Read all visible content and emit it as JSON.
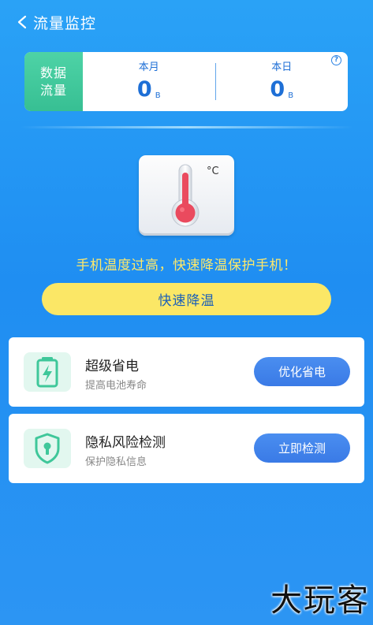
{
  "header": {
    "title": "流量监控"
  },
  "data_card": {
    "label_line1": "数据",
    "label_line2": "流量",
    "month_title": "本月",
    "month_value": "0",
    "month_unit": "B",
    "day_title": "本日",
    "day_value": "0",
    "day_unit": "B",
    "help_icon": "?"
  },
  "thermometer": {
    "unit": "°C"
  },
  "warning_text": "手机温度过高，快速降温保护手机！",
  "cool_button_label": "快速降温",
  "features": [
    {
      "title": "超级省电",
      "subtitle": "提高电池寿命",
      "button": "优化省电",
      "icon": "battery-icon"
    },
    {
      "title": "隐私风险检测",
      "subtitle": "保护隐私信息",
      "button": "立即检测",
      "icon": "shield-lock-icon"
    }
  ],
  "watermark": "大玩客",
  "colors": {
    "accent_green": "#3fc79a",
    "button_yellow": "#fbe766",
    "warning_yellow": "#ffe96a",
    "button_blue": "#3f82eb",
    "thermo_red": "#ea4a5e"
  }
}
